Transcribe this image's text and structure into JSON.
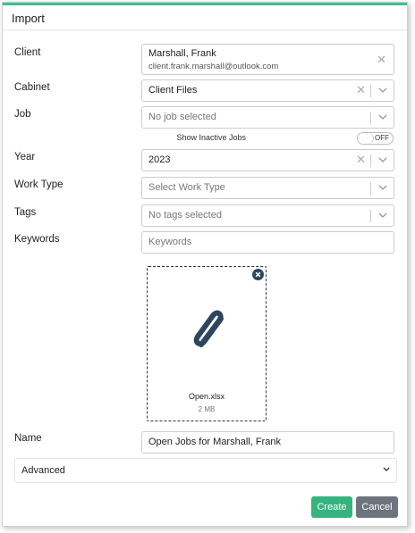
{
  "dialog": {
    "title": "Import"
  },
  "labels": {
    "client": "Client",
    "cabinet": "Cabinet",
    "job": "Job",
    "year": "Year",
    "work_type": "Work Type",
    "tags": "Tags",
    "keywords": "Keywords",
    "name": "Name"
  },
  "client": {
    "name": "Marshall, Frank",
    "email": "client.frank.marshall@outlook.com"
  },
  "cabinet": {
    "value": "Client Files"
  },
  "job": {
    "placeholder": "No job selected"
  },
  "inactive_toggle": {
    "label": "Show Inactive Jobs",
    "state": "OFF"
  },
  "year": {
    "value": "2023"
  },
  "work_type": {
    "placeholder": "Select Work Type"
  },
  "tags": {
    "placeholder": "No tags selected"
  },
  "keywords": {
    "placeholder": "Keywords"
  },
  "attachment": {
    "filename": "Open.xlsx",
    "size": "2 MB",
    "icon": "paperclip-icon"
  },
  "name": {
    "value": "Open Jobs for Marshall, Frank"
  },
  "advanced": {
    "label": "Advanced"
  },
  "buttons": {
    "create": "Create",
    "cancel": "Cancel"
  },
  "colors": {
    "accent": "#3ec08a",
    "create": "#36b37e",
    "cancel": "#6c757d",
    "icon": "#2e4560"
  }
}
